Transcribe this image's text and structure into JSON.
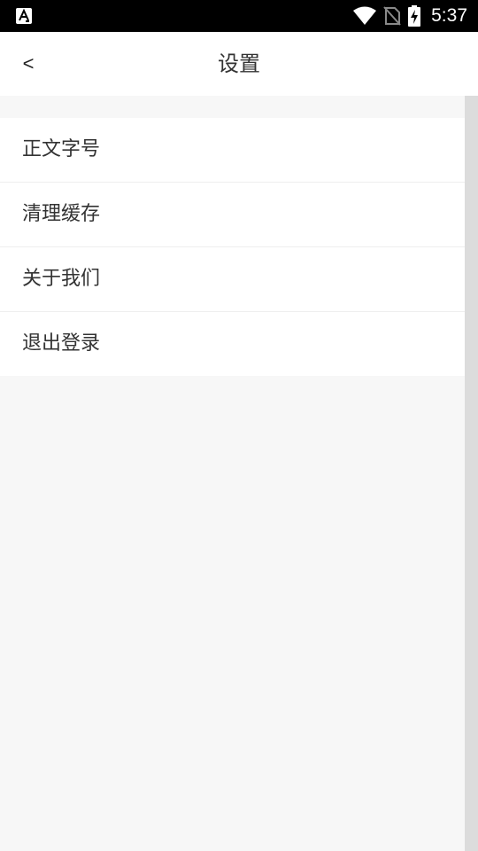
{
  "status_bar": {
    "time": "5:37",
    "icons": [
      "app-notification-icon",
      "wifi-icon",
      "no-sim-icon",
      "battery-charging-icon"
    ]
  },
  "header": {
    "back_label": "<",
    "title": "设置"
  },
  "menu": {
    "items": [
      {
        "label": "正文字号"
      },
      {
        "label": "清理缓存"
      },
      {
        "label": "关于我们"
      },
      {
        "label": "退出登录"
      }
    ]
  },
  "colors": {
    "status_bar_bg": "#000000",
    "header_bg": "#ffffff",
    "page_bg": "#f7f7f7",
    "text": "#333333",
    "scrollbar": "#dcdcdc"
  }
}
